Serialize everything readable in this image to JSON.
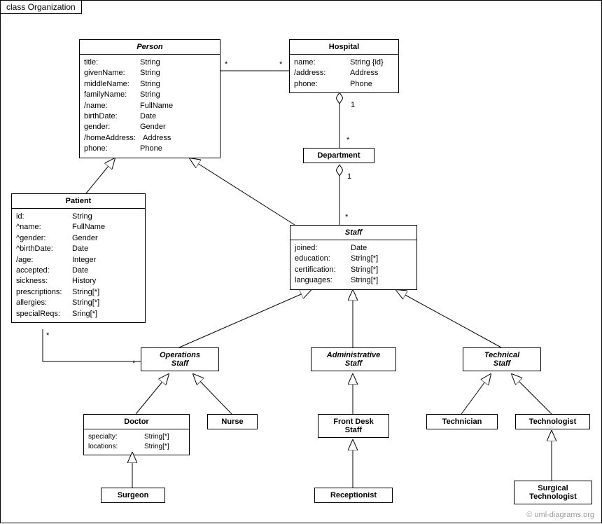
{
  "frame": {
    "title": "class Organization"
  },
  "copyright": "© uml-diagrams.org",
  "classes": {
    "person": {
      "name": "Person",
      "attrs": [
        {
          "k": "title:",
          "v": "String"
        },
        {
          "k": "givenName:",
          "v": "String"
        },
        {
          "k": "middleName:",
          "v": "String"
        },
        {
          "k": "familyName:",
          "v": "String"
        },
        {
          "k": "/name:",
          "v": "FullName"
        },
        {
          "k": "birthDate:",
          "v": "Date"
        },
        {
          "k": "gender:",
          "v": "Gender"
        },
        {
          "k": "/homeAddress:",
          "v": "Address"
        },
        {
          "k": "phone:",
          "v": "Phone"
        }
      ]
    },
    "hospital": {
      "name": "Hospital",
      "attrs": [
        {
          "k": "name:",
          "v": "String {id}"
        },
        {
          "k": "/address:",
          "v": "Address"
        },
        {
          "k": "phone:",
          "v": "Phone"
        }
      ]
    },
    "department": {
      "name": "Department"
    },
    "patient": {
      "name": "Patient",
      "attrs": [
        {
          "k": "id:",
          "v": "String"
        },
        {
          "k": "^name:",
          "v": "FullName"
        },
        {
          "k": "^gender:",
          "v": "Gender"
        },
        {
          "k": "^birthDate:",
          "v": "Date"
        },
        {
          "k": "/age:",
          "v": "Integer"
        },
        {
          "k": "accepted:",
          "v": "Date"
        },
        {
          "k": "sickness:",
          "v": "History"
        },
        {
          "k": "prescriptions:",
          "v": "String[*]"
        },
        {
          "k": "allergies:",
          "v": "String[*]"
        },
        {
          "k": "specialReqs:",
          "v": "Sring[*]"
        }
      ]
    },
    "staff": {
      "name": "Staff",
      "attrs": [
        {
          "k": "joined:",
          "v": "Date"
        },
        {
          "k": "education:",
          "v": "String[*]"
        },
        {
          "k": "certification:",
          "v": "String[*]"
        },
        {
          "k": "languages:",
          "v": "String[*]"
        }
      ]
    },
    "ops": {
      "name": "OperationsStaff",
      "label1": "Operations",
      "label2": "Staff"
    },
    "admin": {
      "name": "AdministrativeStaff",
      "label1": "Administrative",
      "label2": "Staff"
    },
    "tech": {
      "name": "TechnicalStaff",
      "label1": "Technical",
      "label2": "Staff"
    },
    "doctor": {
      "name": "Doctor",
      "attrs": [
        {
          "k": "specialty:",
          "v": "String[*]"
        },
        {
          "k": "locations:",
          "v": "String[*]"
        }
      ]
    },
    "nurse": {
      "name": "Nurse"
    },
    "frontdesk": {
      "name": "FrontDeskStaff",
      "label1": "Front Desk",
      "label2": "Staff"
    },
    "technician": {
      "name": "Technician"
    },
    "technologist": {
      "name": "Technologist"
    },
    "surgeon": {
      "name": "Surgeon"
    },
    "receptionist": {
      "name": "Receptionist"
    },
    "surgtech": {
      "name": "SurgicalTechnologist",
      "label1": "Surgical",
      "label2": "Technologist"
    }
  },
  "mult": {
    "m1": "*",
    "m2": "*",
    "m3": "1",
    "m4": "*",
    "m5": "1",
    "m6": "*",
    "m7": "*",
    "m8": "*"
  }
}
